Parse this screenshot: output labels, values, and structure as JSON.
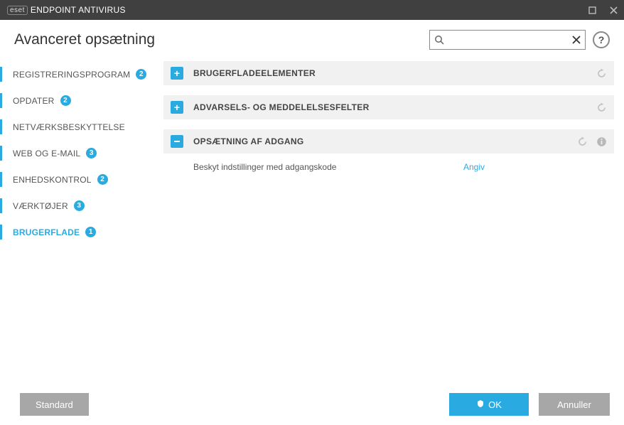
{
  "app": {
    "brand_short": "eset",
    "brand_name": "ENDPOINT ANTIVIRUS"
  },
  "page": {
    "title": "Avanceret opsætning"
  },
  "search": {
    "placeholder": ""
  },
  "help": {
    "glyph": "?"
  },
  "sidebar": {
    "items": [
      {
        "label": "REGISTRERINGSPROGRAM",
        "badge": "2",
        "active": false
      },
      {
        "label": "OPDATER",
        "badge": "2",
        "active": false
      },
      {
        "label": "NETVÆRKSBESKYTTELSE",
        "badge": "",
        "active": false
      },
      {
        "label": "WEB OG E-MAIL",
        "badge": "3",
        "active": false
      },
      {
        "label": "ENHEDSKONTROL",
        "badge": "2",
        "active": false
      },
      {
        "label": "VÆRKTØJER",
        "badge": "3",
        "active": false
      },
      {
        "label": "BRUGERFLADE",
        "badge": "1",
        "active": true
      }
    ]
  },
  "sections": [
    {
      "title": "BRUGERFLADEELEMENTER",
      "expanded": false,
      "reset": true,
      "info": false
    },
    {
      "title": "ADVARSELS- OG MEDDELELSESFELTER",
      "expanded": false,
      "reset": true,
      "info": false
    },
    {
      "title": "OPSÆTNING AF ADGANG",
      "expanded": true,
      "reset": true,
      "info": true,
      "rows": [
        {
          "label": "Beskyt indstillinger med adgangskode",
          "action": "Angiv"
        }
      ]
    }
  ],
  "footer": {
    "default_label": "Standard",
    "ok_label": "OK",
    "cancel_label": "Annuller"
  },
  "icons": {
    "search": "search-icon",
    "clear": "clear-icon",
    "reset": "reset-icon",
    "info": "info-icon",
    "maximize": "maximize-icon",
    "close": "close-icon",
    "shield": "shield-icon"
  },
  "colors": {
    "accent": "#29abe2",
    "titlebar": "#404040",
    "section_bg": "#f1f1f1",
    "grey_btn": "#a7a7a7"
  }
}
